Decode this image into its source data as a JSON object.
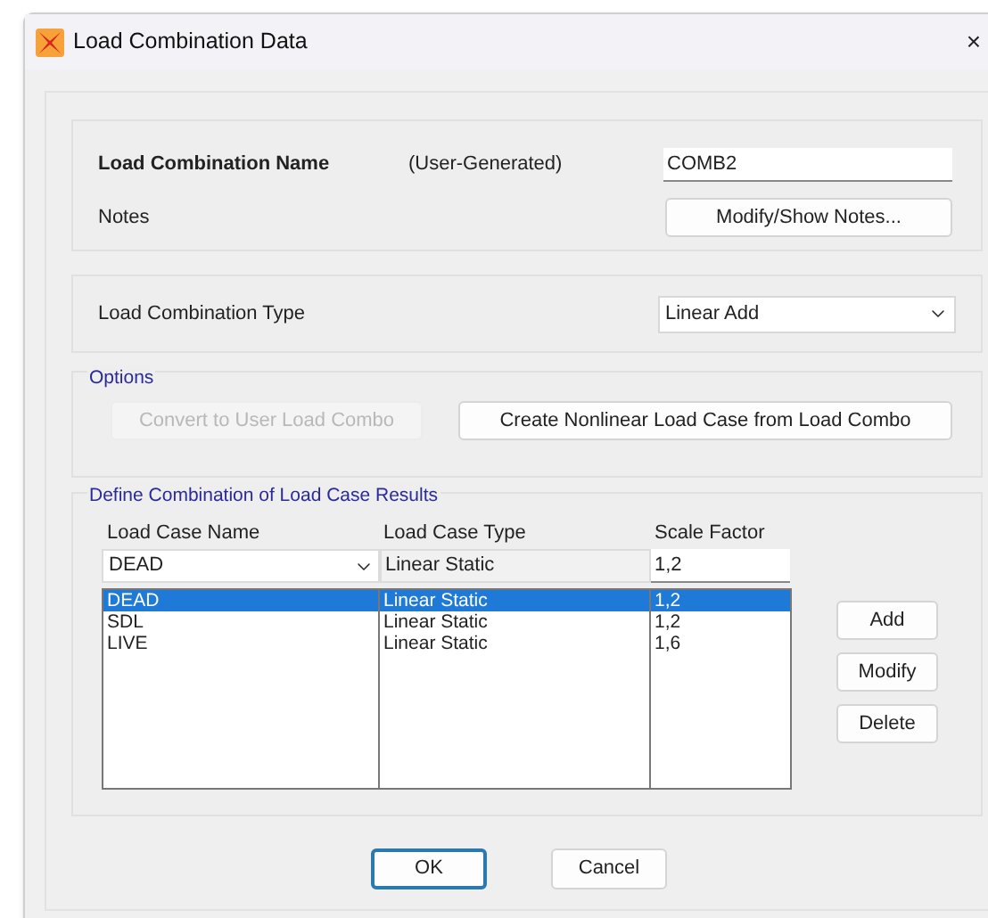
{
  "window": {
    "title": "Load Combination Data",
    "close": "×"
  },
  "name_section": {
    "label": "Load Combination Name",
    "note": "(User-Generated)",
    "value": "COMB2"
  },
  "notes": {
    "label": "Notes",
    "button": "Modify/Show Notes..."
  },
  "combination_type": {
    "label": "Load Combination Type",
    "value": "Linear Add"
  },
  "options": {
    "title": "Options",
    "buttons": [
      {
        "label": "Convert to User Load Combo",
        "disabled": true
      },
      {
        "label": "Create Nonlinear Load Case from Load Combo",
        "disabled": false
      }
    ]
  },
  "define": {
    "title": "Define Combination of Load Case Results",
    "columns": [
      "Load Case Name",
      "Load Case Type",
      "Scale Factor"
    ],
    "editor": {
      "name": "DEAD",
      "type": "Linear Static",
      "scale_factor": "1,2"
    },
    "rows": [
      {
        "name": "DEAD",
        "type": "Linear Static",
        "scale_factor": "1,2",
        "selected": true
      },
      {
        "name": "SDL",
        "type": "Linear Static",
        "scale_factor": "1,2",
        "selected": false
      },
      {
        "name": "LIVE",
        "type": "Linear Static",
        "scale_factor": "1,6",
        "selected": false
      }
    ],
    "buttons": [
      "Add",
      "Modify",
      "Delete"
    ]
  },
  "footer_buttons": [
    {
      "label": "OK",
      "default": true
    },
    {
      "label": "Cancel",
      "default": false
    }
  ]
}
